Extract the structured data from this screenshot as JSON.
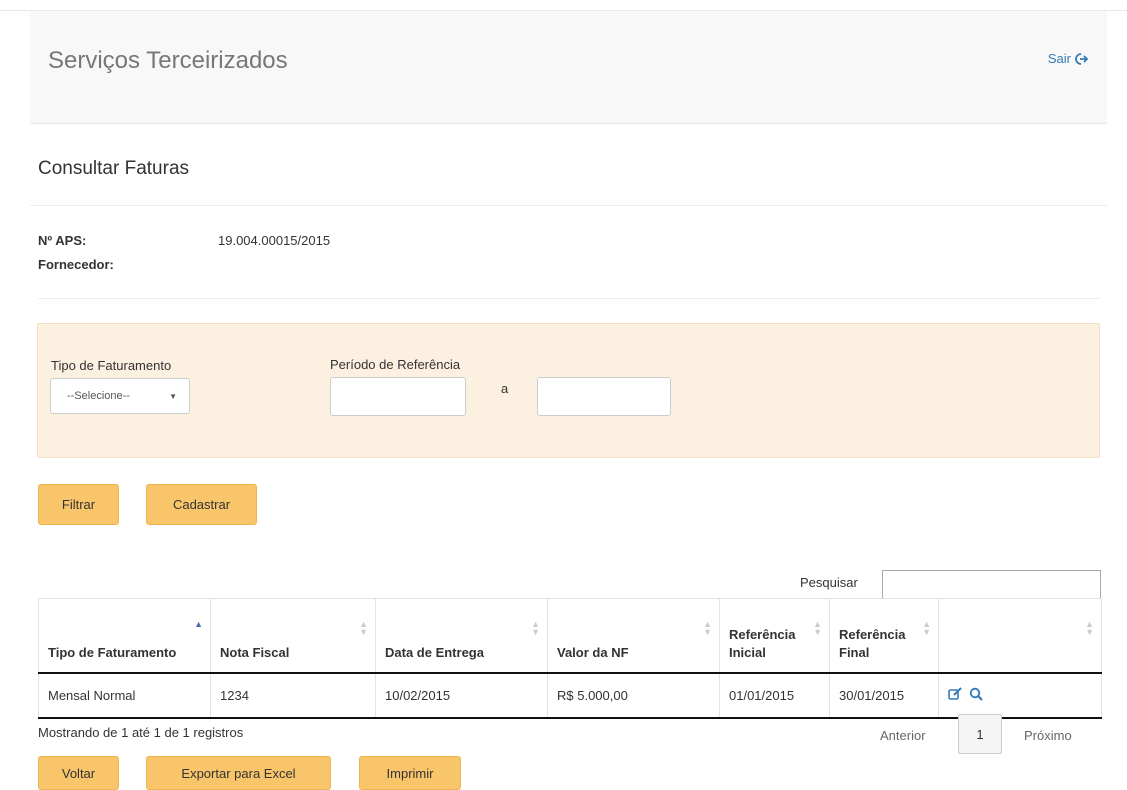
{
  "header": {
    "title": "Serviços Terceirizados",
    "logout_label": "Sair"
  },
  "page": {
    "title": "Consultar Faturas"
  },
  "info": {
    "aps_label": "Nº APS:",
    "aps_value": "19.004.00015/2015",
    "supplier_label": "Fornecedor:"
  },
  "filters": {
    "billing_type_label": "Tipo de Faturamento",
    "billing_type_value": "--Selecione--",
    "period_label": "Período de Referência",
    "period_sep": "a"
  },
  "buttons": {
    "filter": "Filtrar",
    "register": "Cadastrar",
    "back": "Voltar",
    "export": "Exportar para Excel",
    "print": "Imprimir"
  },
  "search": {
    "label": "Pesquisar"
  },
  "table": {
    "columns": [
      "Tipo de Faturamento",
      "Nota Fiscal",
      "Data de Entrega",
      "Valor da NF",
      "Referência Inicial",
      "Referência Final",
      ""
    ],
    "rows": [
      [
        "Mensal Normal",
        "1234",
        "10/02/2015",
        "R$ 5.000,00",
        "01/01/2015",
        "30/01/2015"
      ]
    ],
    "row_actions": [
      "edit-icon",
      "search-icon"
    ]
  },
  "pagination": {
    "info": "Mostrando de 1 até 1 de 1 registros",
    "prev": "Anterior",
    "current": "1",
    "next": "Próximo"
  },
  "colors": {
    "accent_button": "#f8c56a",
    "filter_panel": "#fcf0e0",
    "link": "#337ab7"
  }
}
